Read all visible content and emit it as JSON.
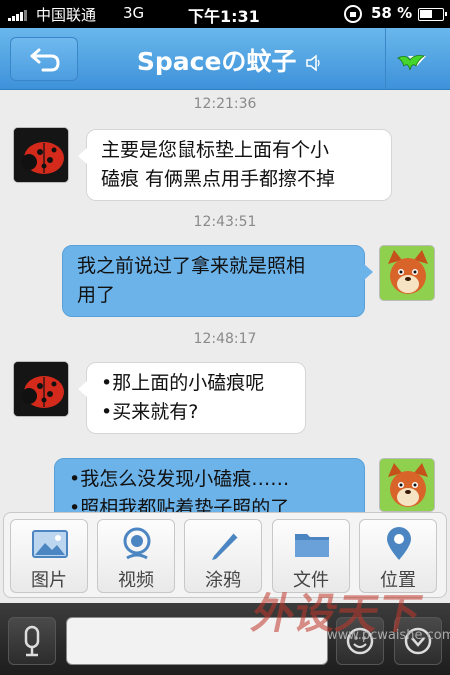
{
  "status_bar": {
    "carrier": "中国联通",
    "network": "3G",
    "time": "下午1:31",
    "battery": "58 %"
  },
  "nav": {
    "title": "Spaceの蚊子",
    "back_icon": "back-arrow-icon",
    "more_icon": "dropdown-arrow-icon",
    "accent": "#4a9ee0"
  },
  "messages": [
    {
      "timestamp": "12:21:36",
      "direction": "in",
      "avatar": "ladybug",
      "lines": [
        "主要是您鼠标垫上面有个小",
        "磕痕 有俩黑点用手都擦不掉"
      ]
    },
    {
      "timestamp": "12:43:51",
      "direction": "out",
      "avatar": "fox",
      "lines": [
        "我之前说过了拿来就是照相",
        "用了"
      ]
    },
    {
      "timestamp": "12:48:17",
      "direction": "in",
      "avatar": "ladybug",
      "lines": [
        "•那上面的小磕痕呢",
        "•买来就有?"
      ]
    },
    {
      "timestamp": "",
      "direction": "out",
      "avatar": "fox",
      "lines": [
        "•我怎么没发现小磕痕……",
        "•照相我都贴着垫子照的了"
      ]
    }
  ],
  "attachments": [
    {
      "label": "图片",
      "icon": "image-icon"
    },
    {
      "label": "视频",
      "icon": "video-icon"
    },
    {
      "label": "涂鸦",
      "icon": "pencil-icon"
    },
    {
      "label": "文件",
      "icon": "folder-icon"
    },
    {
      "label": "位置",
      "icon": "location-pin-icon"
    }
  ],
  "input": {
    "value": ""
  },
  "watermark": {
    "text": "外设天下",
    "url": "www.pcwaishe.com"
  }
}
